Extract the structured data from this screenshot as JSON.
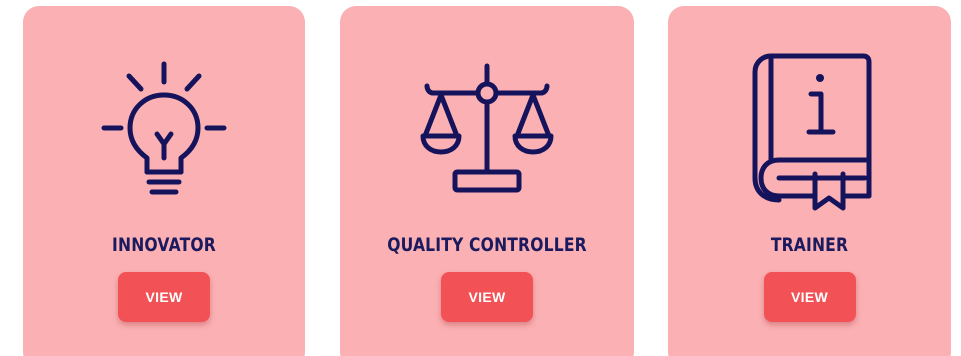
{
  "theme": {
    "card_bg": "#fbb1b3",
    "icon_color": "#15135c",
    "title_color": "#1b1a5e",
    "button_bg": "#f25256",
    "button_text": "#ffffff"
  },
  "cards": [
    {
      "icon": "lightbulb-icon",
      "title": "INNOVATOR",
      "button_label": "VIEW"
    },
    {
      "icon": "scales-icon",
      "title": "QUALITY CONTROLLER",
      "button_label": "VIEW"
    },
    {
      "icon": "info-book-icon",
      "title": "TRAINER",
      "button_label": "VIEW"
    }
  ]
}
